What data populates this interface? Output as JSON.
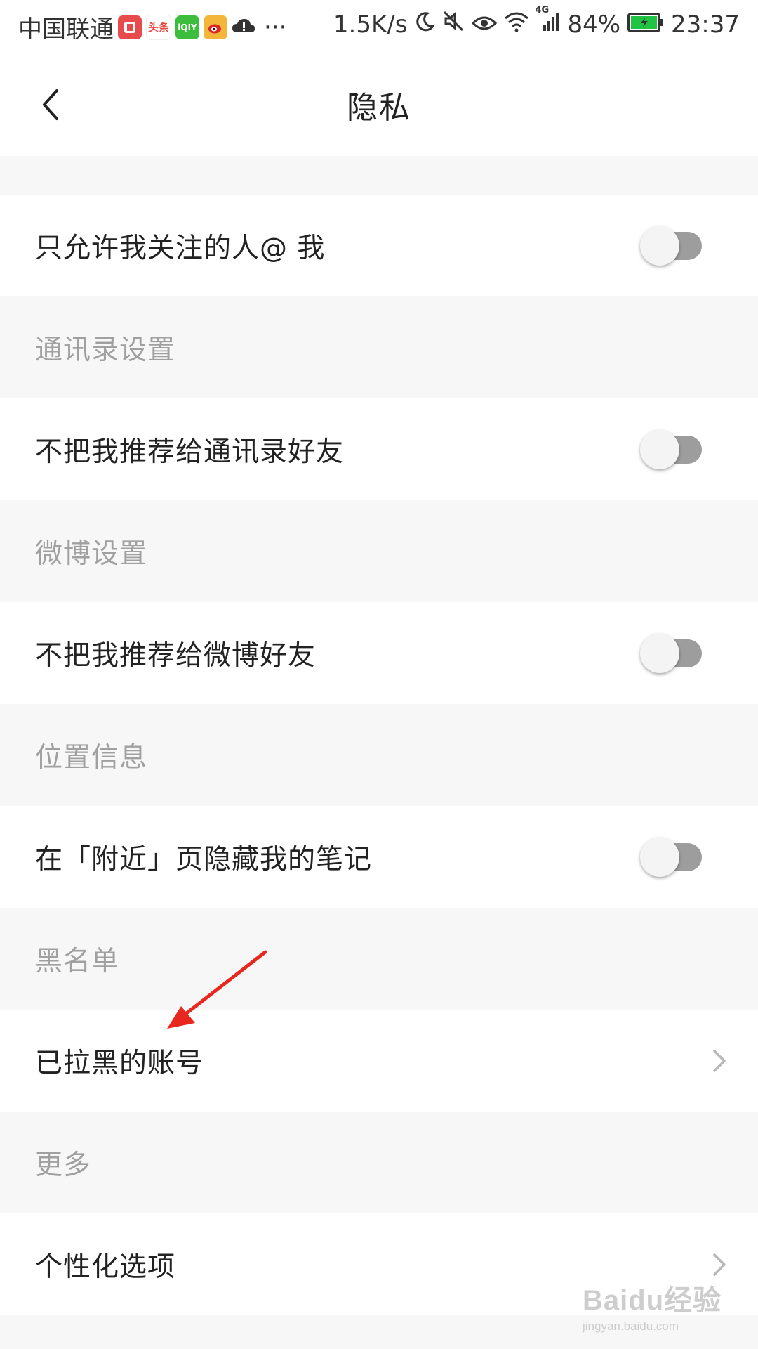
{
  "status_bar": {
    "carrier": "中国联通",
    "net_speed": "1.5K/s",
    "network_type": "4G",
    "battery": "84%",
    "time": "23:37",
    "app_icons": [
      {
        "name": "toutiao-reader-icon",
        "glyph": "",
        "color": "#e84b4b"
      },
      {
        "name": "toutiao-icon",
        "glyph": "头条",
        "color": "#e8473e"
      },
      {
        "name": "iqiyi-icon",
        "glyph": "iQIY",
        "color": "#3dbd3d"
      },
      {
        "name": "weibo-icon",
        "glyph": "",
        "color": "#f3b63a"
      }
    ],
    "more": "···"
  },
  "nav": {
    "title": "隐私"
  },
  "items": {
    "mention_only_following": {
      "label": "只允许我关注的人@ 我",
      "enabled": false
    },
    "contacts_section": "通讯录设置",
    "no_recommend_contacts": {
      "label": "不把我推荐给通讯录好友",
      "enabled": false
    },
    "weibo_section": "微博设置",
    "no_recommend_weibo": {
      "label": "不把我推荐给微博好友",
      "enabled": false
    },
    "location_section": "位置信息",
    "hide_nearby_notes": {
      "label": "在「附近」页隐藏我的笔记",
      "enabled": false
    },
    "blacklist_section": "黑名单",
    "blocked_accounts": {
      "label": "已拉黑的账号"
    },
    "more_section": "更多",
    "personalization": {
      "label": "个性化选项"
    }
  },
  "watermark": {
    "main": "Baidu经验",
    "sub": "jingyan.baidu.com"
  },
  "colors": {
    "background": "#f7f7f7",
    "row_background": "#ffffff",
    "section_text": "#a0a0a0",
    "annotation_arrow": "#e8281e"
  }
}
